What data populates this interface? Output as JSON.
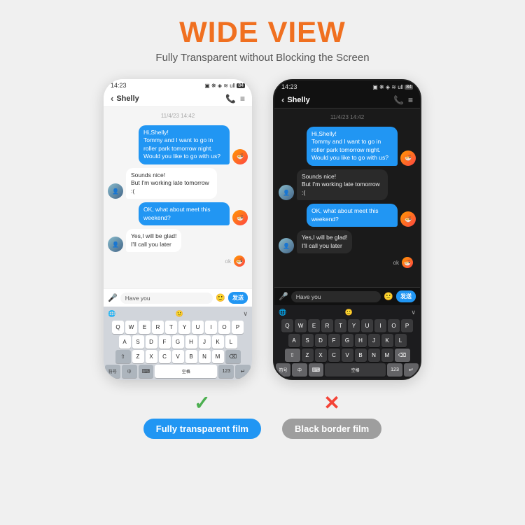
{
  "header": {
    "title": "WIDE VIEW",
    "subtitle": "Fully Transparent without Blocking the Screen"
  },
  "left_phone": {
    "status_time": "14:23",
    "status_icons": "▣ ❋ ◈ ≋ ull 84",
    "contact_name": "Shelly",
    "chat_date": "11/4/23 14:42",
    "messages": [
      {
        "type": "sent",
        "text": "Hi,Shelly!\nTommy and I want to go in roller\npark tomorrow night. Would you\nlike to go with us?"
      },
      {
        "type": "received",
        "text": "Sounds nice!\nBut I'm working late tomorrow :("
      },
      {
        "type": "sent",
        "text": "OK, what about meet this\nweekend?"
      },
      {
        "type": "received",
        "text": "Yes,I will be glad!\nI'll call you later"
      }
    ],
    "ok_text": "ok",
    "input_text": "Have you",
    "send_label": "发送",
    "keyboard_rows": [
      [
        "Q",
        "W",
        "E",
        "R",
        "T",
        "Y",
        "U",
        "I",
        "O",
        "P"
      ],
      [
        "A",
        "S",
        "D",
        "F",
        "G",
        "H",
        "J",
        "K",
        "L"
      ],
      [
        "Z",
        "X",
        "C",
        "V",
        "B",
        "N",
        "M"
      ]
    ],
    "bottom_keys": [
      "符号",
      "中",
      "⌨",
      "空格",
      "123",
      "↵"
    ]
  },
  "right_phone": {
    "status_time": "14:23",
    "status_icons": "▣ ❋ ◈ ≋ ull 84",
    "contact_name": "Shelly",
    "chat_date": "11/4/23 14:42",
    "messages": [
      {
        "type": "sent",
        "text": "Hi,Shelly!\nTommy and I want to go in roller\npark tomorrow night. Would you\nlike to go with us?"
      },
      {
        "type": "received",
        "text": "Sounds nice!\nBut I'm working late tomorrow :("
      },
      {
        "type": "sent",
        "text": "OK, what about meet this\nweekend?"
      },
      {
        "type": "received",
        "text": "Yes,I will be glad!\nI'll call you later"
      }
    ],
    "ok_text": "ok",
    "input_text": "Have you",
    "send_label": "发送",
    "keyboard_rows": [
      [
        "Q",
        "W",
        "E",
        "R",
        "T",
        "Y",
        "U",
        "I",
        "O",
        "P"
      ],
      [
        "A",
        "S",
        "D",
        "F",
        "G",
        "H",
        "J",
        "K",
        "L"
      ],
      [
        "Z",
        "X",
        "C",
        "V",
        "B",
        "N",
        "M"
      ]
    ],
    "bottom_keys": [
      "符号",
      "中",
      "⌨",
      "空格",
      "123",
      "↵"
    ]
  },
  "labels": {
    "left_check": "✓",
    "left_label": "Fully transparent film",
    "right_cross": "✕",
    "right_label": "Black border film"
  }
}
